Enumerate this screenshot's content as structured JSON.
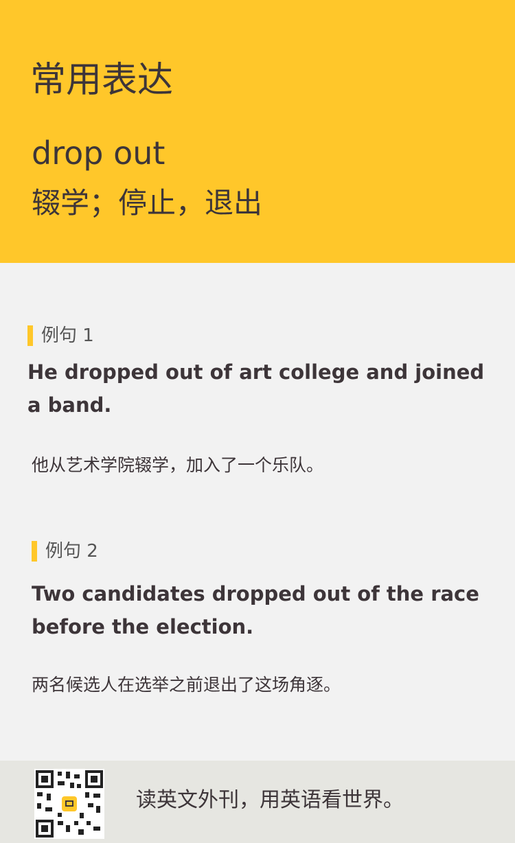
{
  "header": {
    "section_title": "常用表达",
    "phrase": "drop out",
    "meaning": "辍学；停止，退出",
    "accent_color": "#ffc72a"
  },
  "examples": [
    {
      "label": "例句 1",
      "english": "He dropped out of art college and joined a band.",
      "chinese": "他从艺术学院辍学，加入了一个乐队。"
    },
    {
      "label": "例句 2",
      "english": "Two candidates dropped out of the race before the election.",
      "chinese": "两名候选人在选举之前退出了这场角逐。"
    }
  ],
  "footer": {
    "qr_icon": "qr-code",
    "slogan": "读英文外刊，用英语看世界。"
  }
}
